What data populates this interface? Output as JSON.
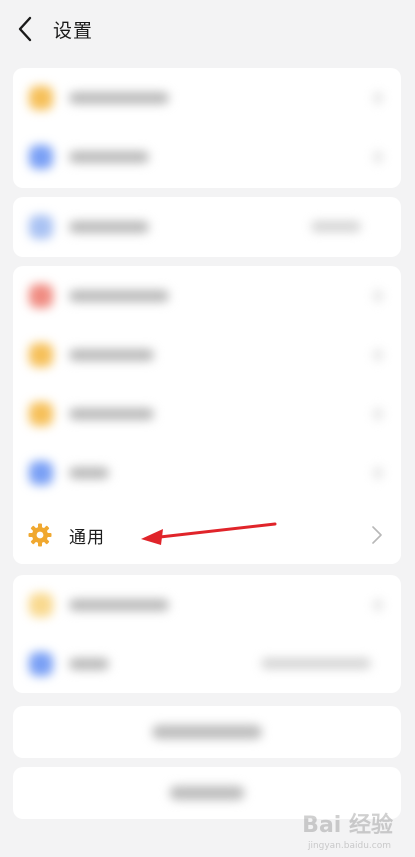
{
  "header": {
    "title": "设置"
  },
  "general": {
    "label": "通用"
  },
  "watermark": {
    "text": "Bai 经验",
    "sub": "jingyan.baidu.com"
  },
  "colors": {
    "accent_orange": "#f0a830",
    "arrow_red": "#e0242a",
    "blur_blue": "#7aa0f5",
    "blur_red": "#f08c82"
  },
  "icons": [
    "back-arrow-icon",
    "gear-icon",
    "chevron-right-icon"
  ]
}
